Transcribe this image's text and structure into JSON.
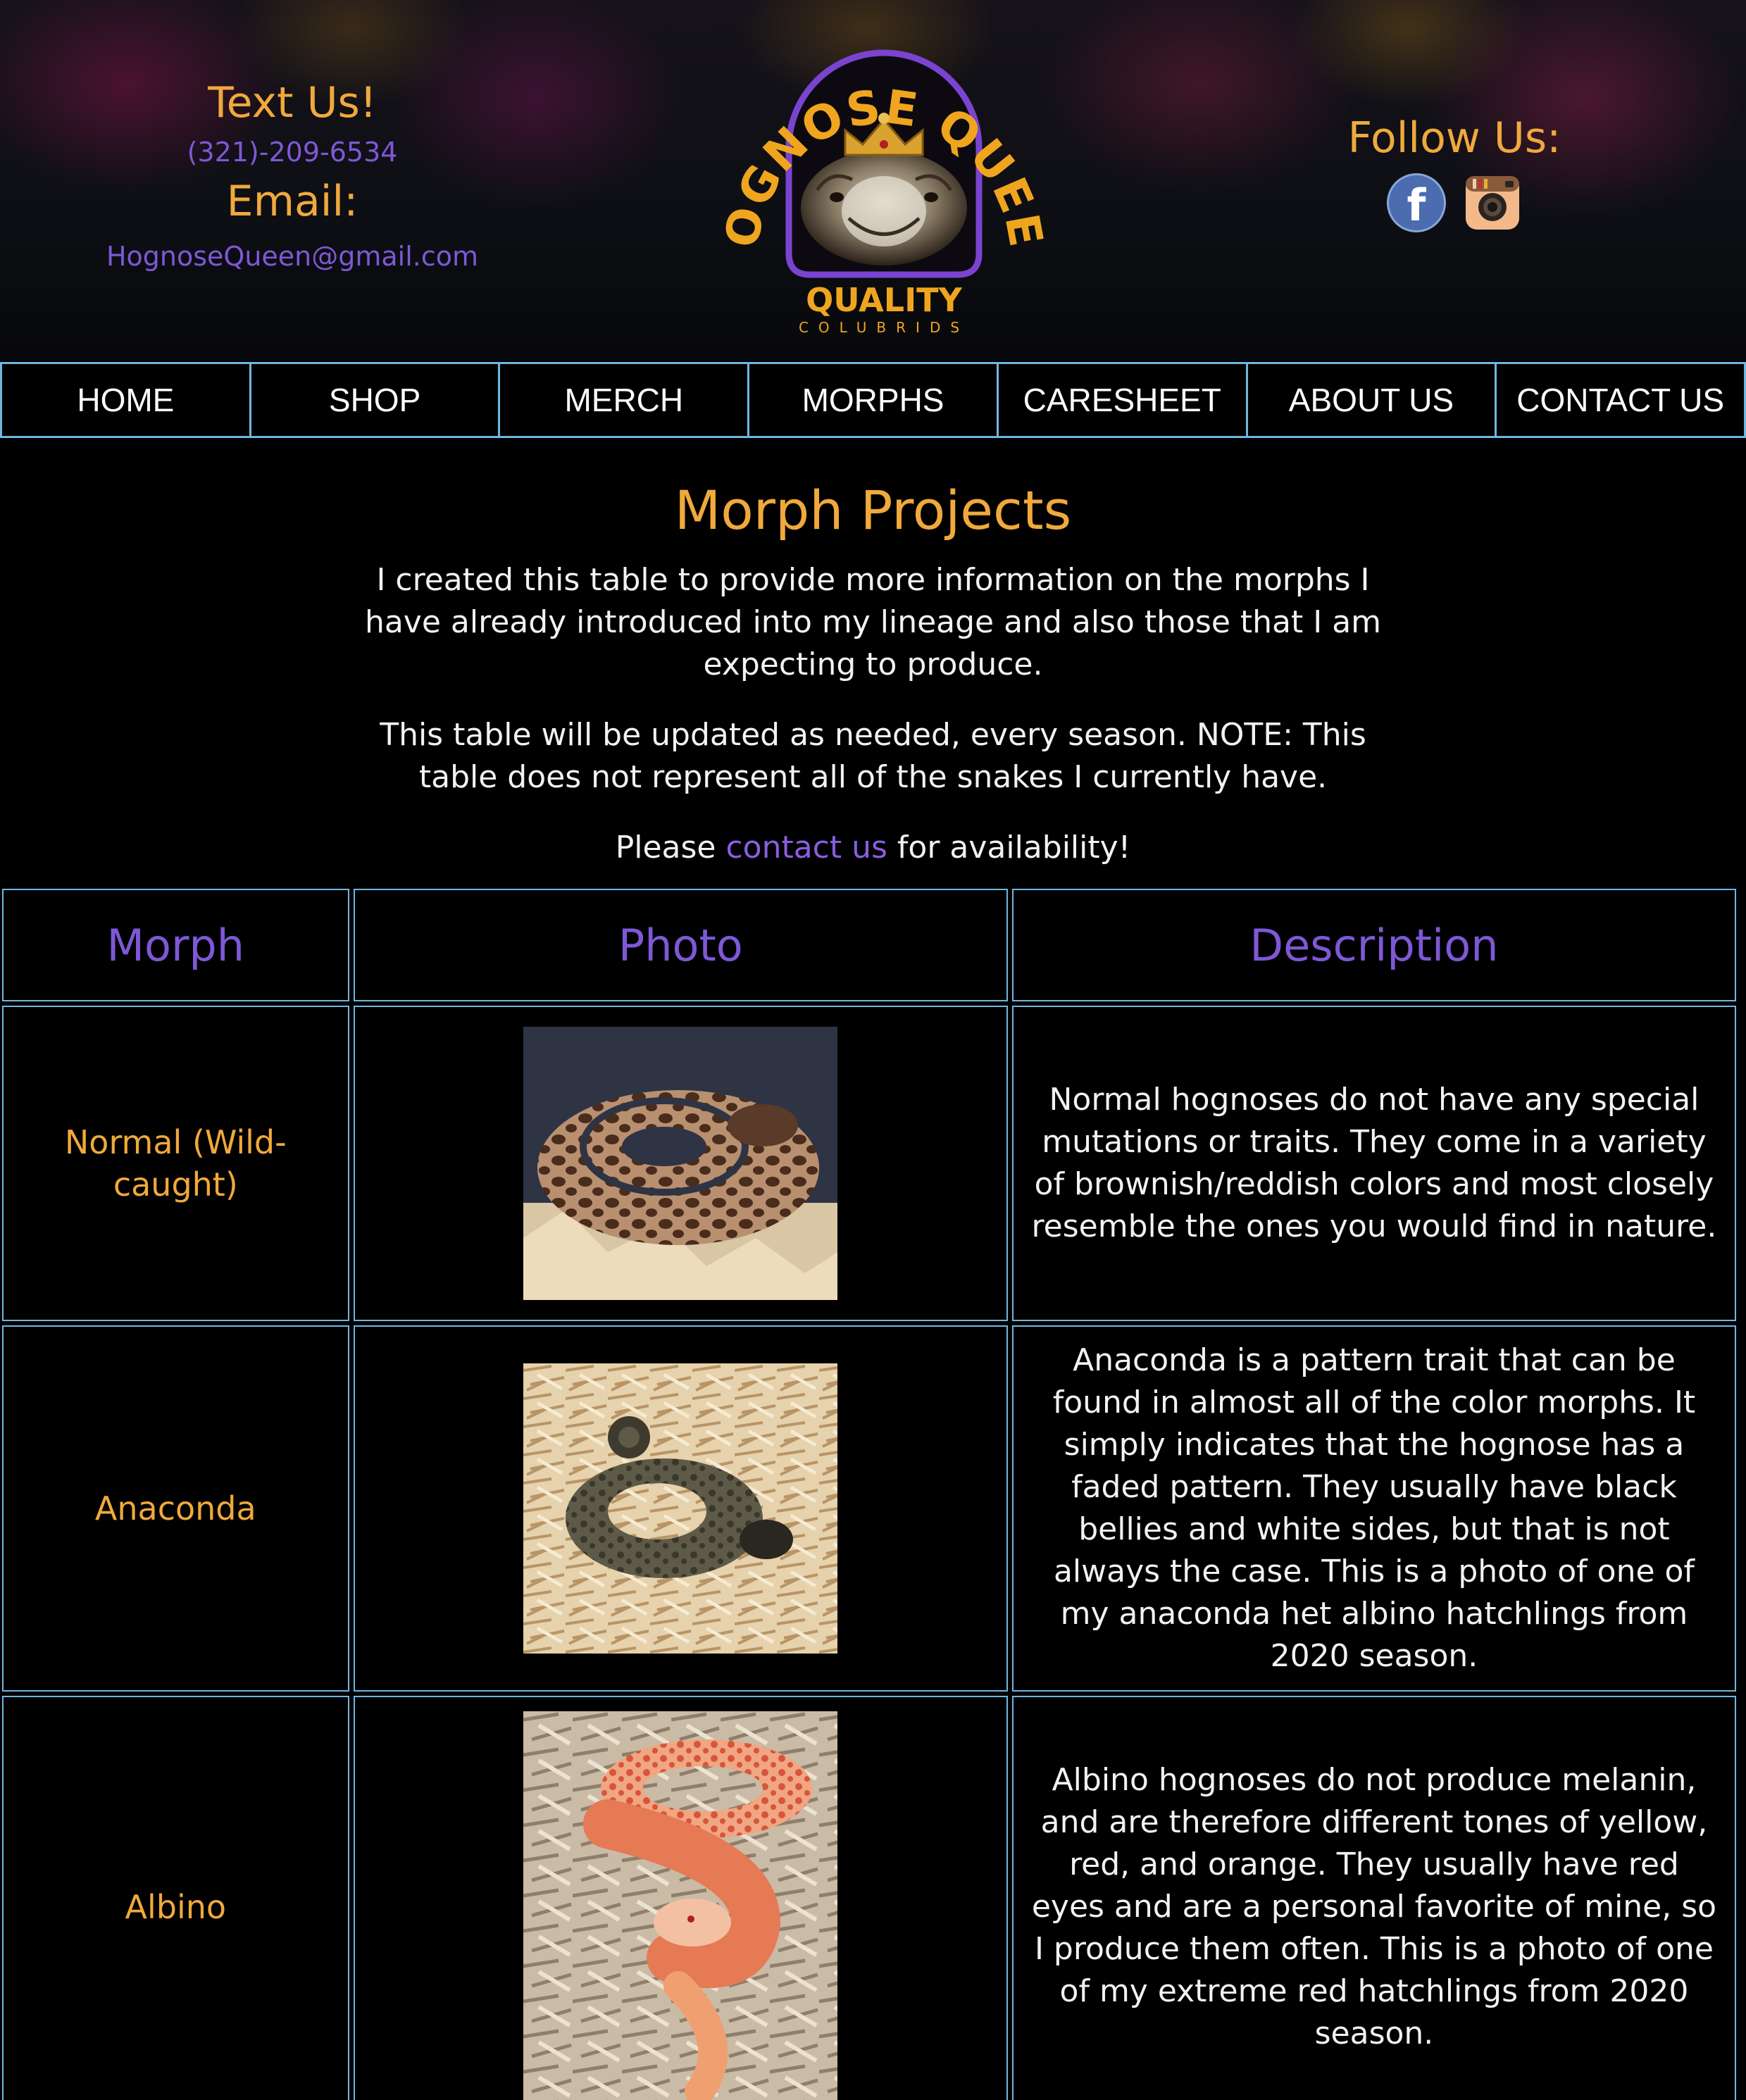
{
  "header": {
    "text_us_label": "Text Us!",
    "phone": "(321)-209-6534",
    "email_label": "Email:",
    "email": "HognoseQueen@gmail.com",
    "logo": {
      "top_text": "HOGNOSE QUEEN",
      "quality": "QUALITY",
      "colubrids": "COLUBRIDS"
    },
    "follow_label": "Follow Us:",
    "social": [
      {
        "name": "facebook",
        "icon": "facebook-icon"
      },
      {
        "name": "instagram",
        "icon": "instagram-icon"
      }
    ]
  },
  "nav": [
    {
      "label": "HOME"
    },
    {
      "label": "SHOP"
    },
    {
      "label": "MERCH"
    },
    {
      "label": "MORPHS"
    },
    {
      "label": "CARESHEET"
    },
    {
      "label": "ABOUT US"
    },
    {
      "label": "CONTACT US"
    }
  ],
  "intro": {
    "title": "Morph Projects",
    "para1": "I created this table to provide more information on the morphs I have already introduced into my lineage and also those that I am expecting to produce.",
    "para2": "This table will be updated as needed, every season. NOTE: This table does not represent all of the snakes I currently have.",
    "para3_before": "Please ",
    "para3_link": "contact us",
    "para3_after": " for availability!"
  },
  "table": {
    "headers": [
      "Morph",
      "Photo",
      "Description"
    ],
    "rows": [
      {
        "morph": "Normal (Wild-caught)",
        "description": "Normal hognoses do not have any special mutations or traits. They come in a variety of brownish/reddish colors and most closely resemble the ones you would find in nature."
      },
      {
        "morph": "Anaconda",
        "description": "Anaconda is a pattern trait that can be found in almost all of the color morphs. It simply indicates that the hognose has a faded pattern. They usually have black bellies and white sides, but that is not always the case. This is a photo of one of my anaconda het albino hatchlings from 2020 season."
      },
      {
        "morph": "Albino",
        "description": "Albino hognoses do not produce melanin, and are therefore different tones of yellow, red, and orange. They usually have red eyes and are a personal favorite of mine, so I produce them often. This is a photo of one of my extreme red hatchlings from 2020 season."
      }
    ]
  },
  "colors": {
    "accent_orange": "#f0a93c",
    "accent_purple": "#7e58d6",
    "border_blue": "#6fb7e0",
    "background": "#000000"
  }
}
